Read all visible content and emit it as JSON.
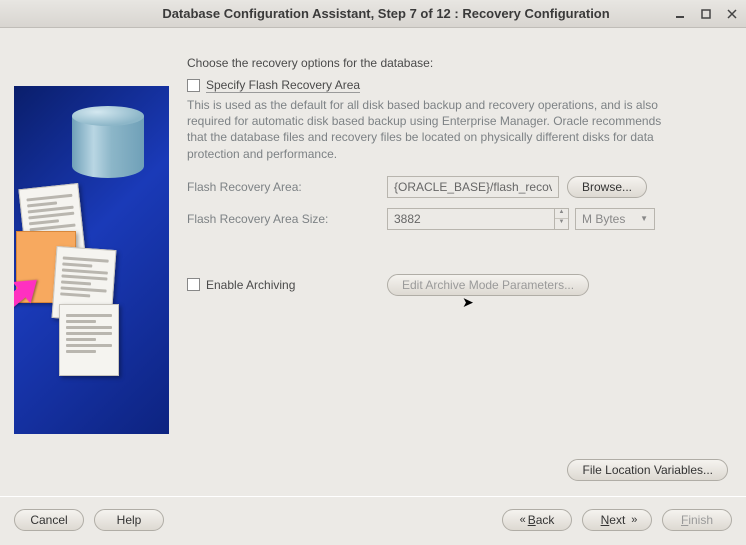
{
  "window": {
    "title": "Database Configuration Assistant, Step 7 of 12 : Recovery Configuration"
  },
  "intro": "Choose the recovery options for the database:",
  "specify": {
    "checkbox_label": "Specify Flash Recovery Area",
    "description": "This is used as the default for all disk based backup and recovery operations, and is also required for automatic disk based backup using Enterprise Manager. Oracle recommends that the database files and recovery files be located on physically different disks for data protection and performance.",
    "fra_label": "Flash Recovery Area:",
    "fra_value": "{ORACLE_BASE}/flash_recovery_",
    "browse_label": "Browse...",
    "fra_size_label": "Flash Recovery Area Size:",
    "fra_size_value": "3882",
    "unit_selected": "M Bytes"
  },
  "archiving": {
    "checkbox_label": "Enable Archiving",
    "edit_label": "Edit Archive Mode Parameters..."
  },
  "file_loc_label": "File Location Variables...",
  "footer": {
    "cancel": "Cancel",
    "help": "Help",
    "back": "Back",
    "next": "Next",
    "finish": "Finish"
  }
}
